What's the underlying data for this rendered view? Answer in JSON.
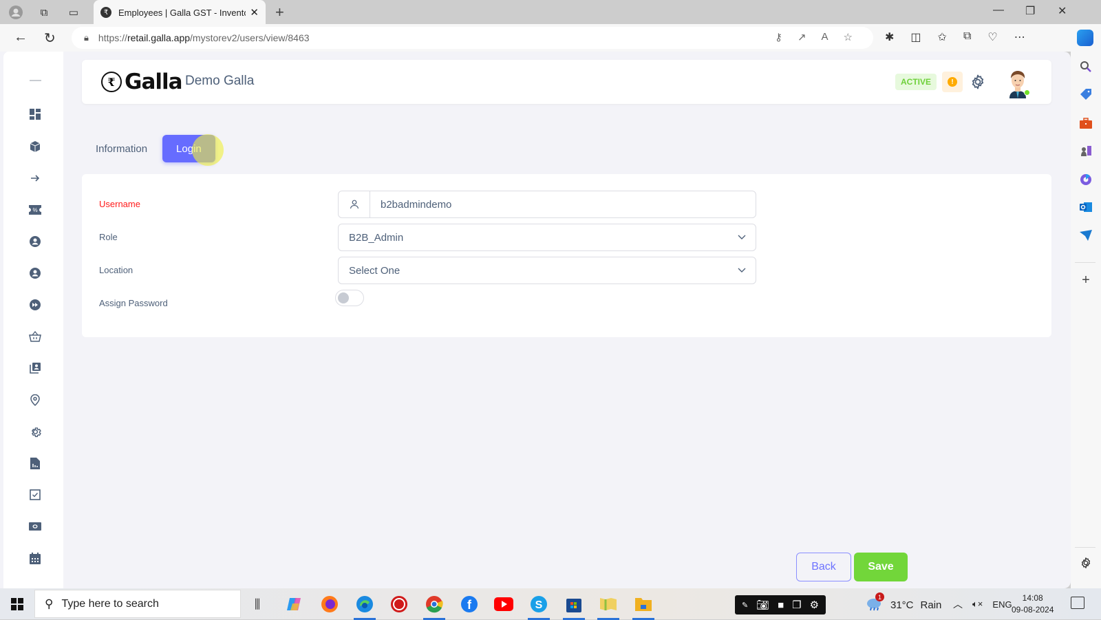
{
  "browser": {
    "tab_title": "Employees | Galla GST - Inventory",
    "url_domain": "retail.galla.app",
    "url_scheme": "https://",
    "url_path": "/mystorev2/users/view/8463"
  },
  "header": {
    "brand": "Galla",
    "store_name": "Demo Galla",
    "status_badge": "ACTIVE",
    "alert_glyph": "!",
    "colors": {
      "primary": "#666cff",
      "success": "#72e128",
      "warning": "#ffab00"
    }
  },
  "tabs": [
    {
      "label": "Information",
      "active": false
    },
    {
      "label": "Login",
      "active": true
    }
  ],
  "form": {
    "username": {
      "label": "Username",
      "value": "b2badmindemo",
      "required": true
    },
    "role": {
      "label": "Role",
      "selected": "B2B_Admin"
    },
    "location": {
      "label": "Location",
      "selected": "Select One"
    },
    "assign_password": {
      "label": "Assign Password",
      "enabled": false
    }
  },
  "actions": {
    "back": "Back",
    "save": "Save"
  },
  "sidebar": {
    "icons": [
      "dashboard-icon",
      "box-icon",
      "arrow-right-icon",
      "coupon-icon",
      "user-circle-icon",
      "user-circle-icon",
      "fast-forward-icon",
      "basket-icon",
      "contacts-icon",
      "location-pin-icon",
      "settings-icon",
      "report-icon",
      "checkbox-icon",
      "cash-icon",
      "calendar-icon"
    ]
  },
  "taskbar": {
    "search_placeholder": "Type here to search",
    "weather_temp": "31°C",
    "weather_desc": "Rain",
    "weather_badge": "1",
    "language": "ENG",
    "time": "14:08",
    "date": "09-08-2024"
  }
}
